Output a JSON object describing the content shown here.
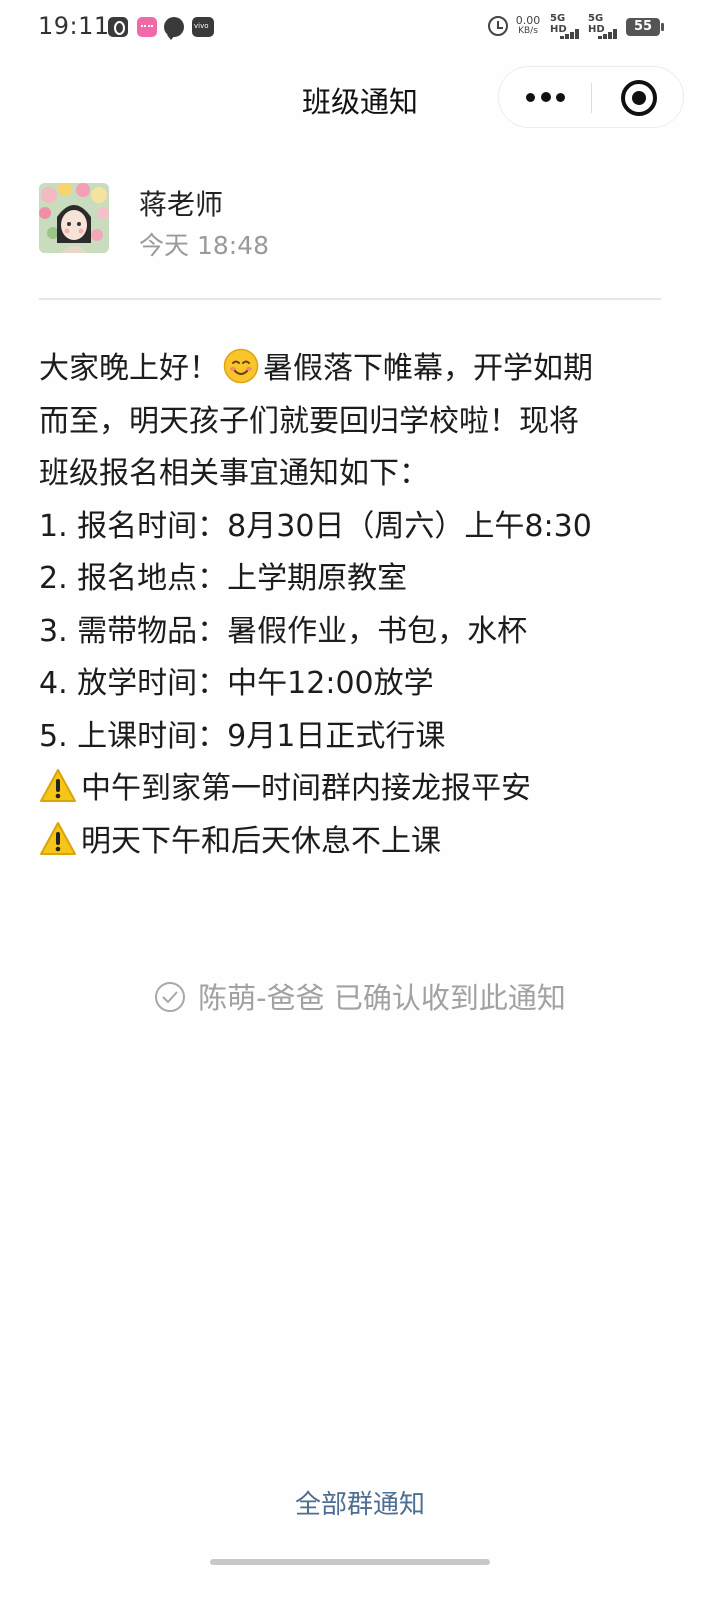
{
  "status_bar": {
    "time": "19:11",
    "net_speed_value": "0.00",
    "net_speed_unit": "KB/s",
    "signal_1_label": "5G HD",
    "signal_2_label": "5G HD",
    "battery_level": "55"
  },
  "header": {
    "title": "班级通知"
  },
  "author": {
    "name": "蒋老师",
    "time": "今天 18:48"
  },
  "notice": {
    "line_1_before_emoji": "大家晚上好！",
    "line_1_after_emoji": "暑假落下帷幕，开学如期",
    "line_2": "而至，明天孩子们就要回归学校啦！现将",
    "line_3": "班级报名相关事宜通知如下：",
    "line_4": "1. 报名时间：8月30日（周六）上午8:30",
    "line_5": "2. 报名地点：上学期原教室",
    "line_6": "3. 需带物品：暑假作业，书包，水杯",
    "line_7": "4. 放学时间：中午12:00放学",
    "line_8": "5. 上课时间：9月1日正式行课",
    "warning_1": "中午到家第一时间群内接龙报平安",
    "warning_2": "明天下午和后天休息不上课"
  },
  "confirmation": {
    "text": "陈萌-爸爸 已确认收到此通知"
  },
  "footer": {
    "all_notices_link": "全部群通知"
  },
  "colors": {
    "link": "#4e6d92",
    "muted_text": "#9a9a9a",
    "warning_yellow": "#f5c518"
  }
}
